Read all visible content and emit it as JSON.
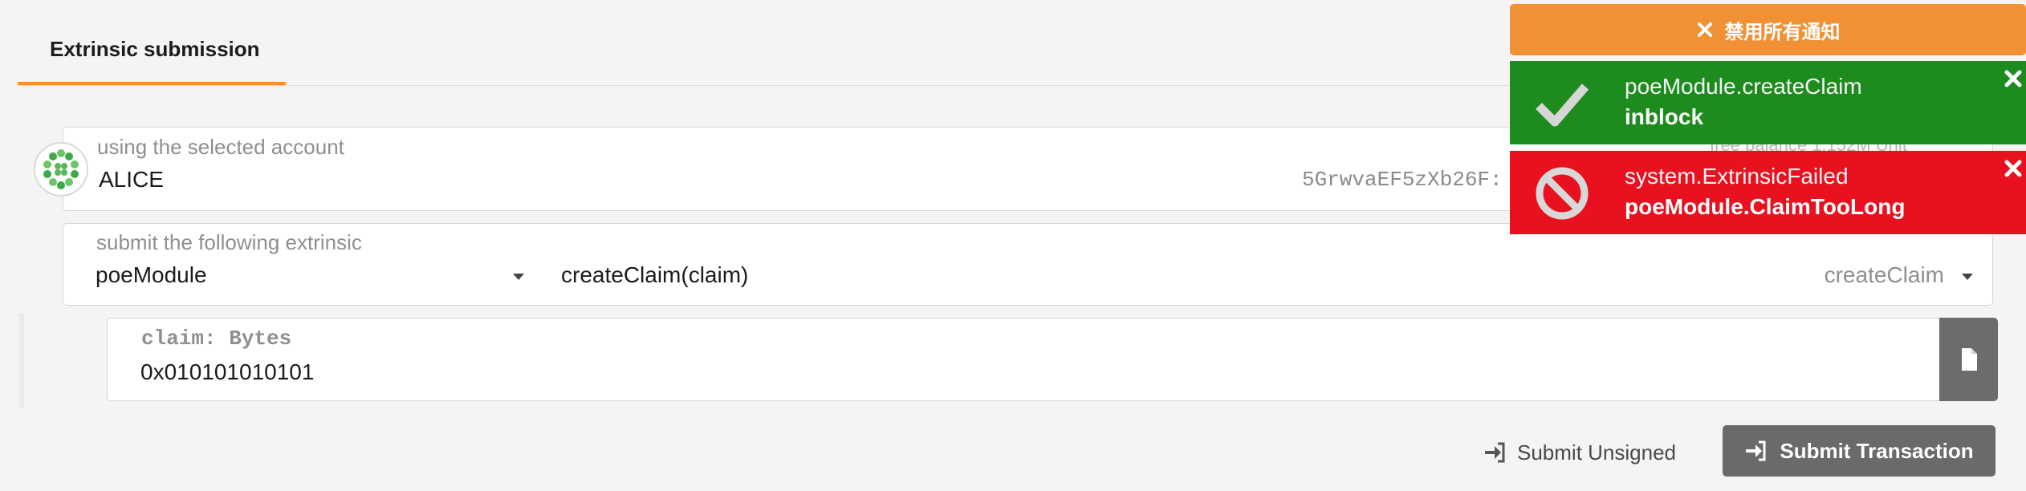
{
  "tab": {
    "label": "Extrinsic submission"
  },
  "account": {
    "label": "using the selected account",
    "name": "ALICE",
    "address": "5GrwvaEF5zXb26F:",
    "balance_label": "free balance 1.152M Unit"
  },
  "extrinsic": {
    "label": "submit the following extrinsic",
    "module": "poeModule",
    "call": "createClaim(claim)",
    "method": "createClaim"
  },
  "param": {
    "label": "claim: Bytes",
    "value": "0x010101010101"
  },
  "actions": {
    "unsigned_label": "Submit Unsigned",
    "submit_label": "Submit Transaction"
  },
  "notifications": {
    "disable_label": "禁用所有通知",
    "items": [
      {
        "title": "poeModule.createClaim",
        "status": "inblock",
        "type": "success",
        "color": "#1e8b1e",
        "icon": "checkmark-icon"
      },
      {
        "title": "system.ExtrinsicFailed",
        "status": "poeModule.ClaimTooLong",
        "type": "error",
        "color": "#e9111f",
        "icon": "ban-icon"
      }
    ]
  },
  "colors": {
    "accent": "#f19135",
    "button": "#6a6a6a"
  }
}
